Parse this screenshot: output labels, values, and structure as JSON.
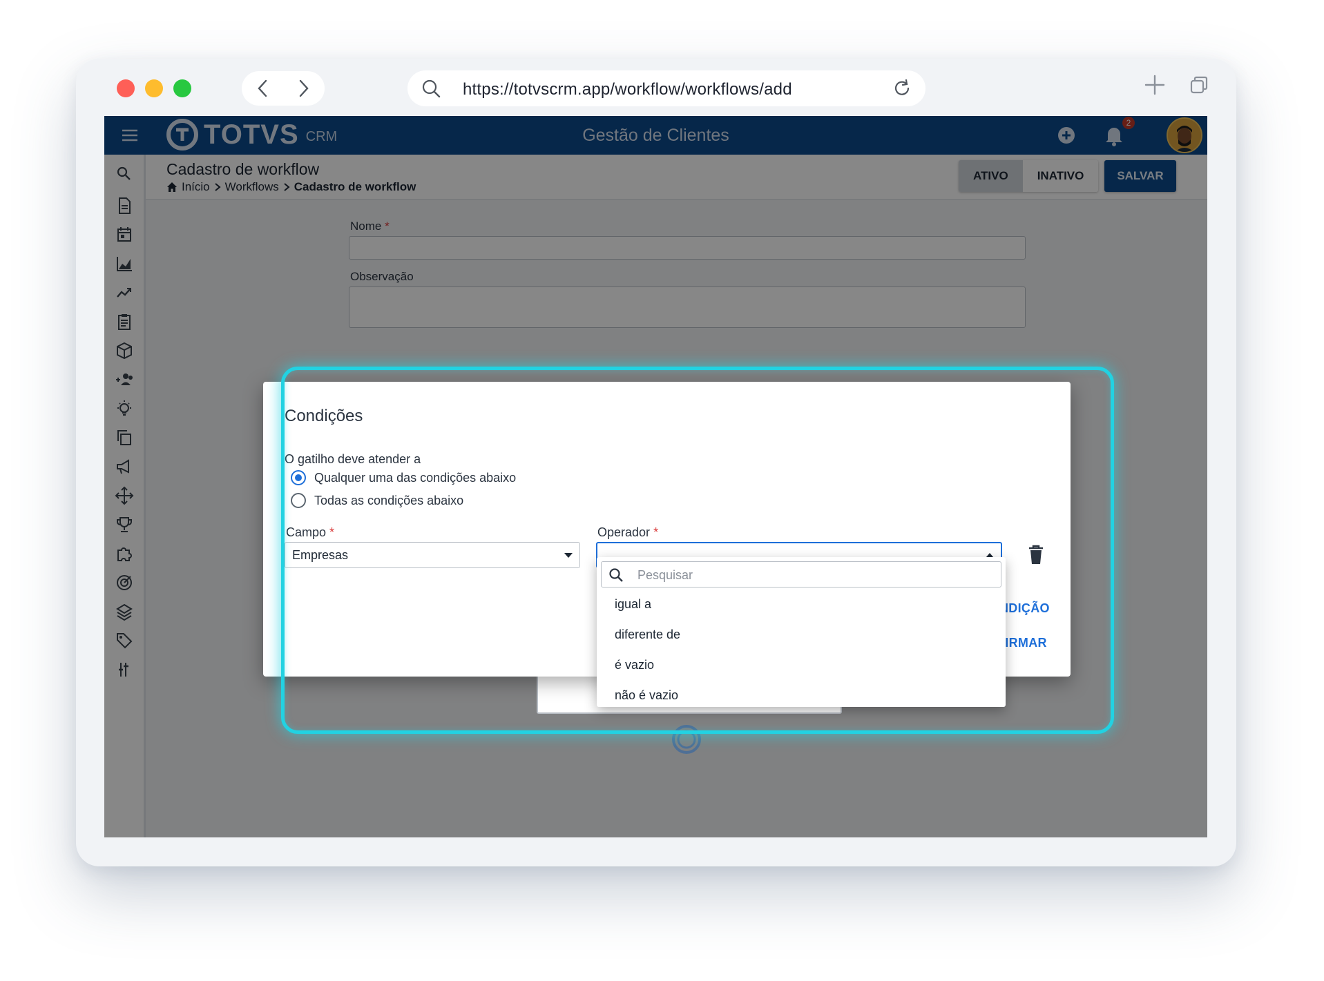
{
  "browser": {
    "url": "https://totvscrm.app/workflow/workflows/add"
  },
  "topbar": {
    "logo": "TOTVS",
    "logo_sub": "CRM",
    "app_title": "Gestão de Clientes",
    "notification_count": "2"
  },
  "sidebar": {
    "icons": [
      "search-icon",
      "document-icon",
      "calendar-icon",
      "area-chart-icon",
      "trend-icon",
      "clipboard-icon",
      "box-icon",
      "people-add-icon",
      "lightbulb-icon",
      "copy-icon",
      "megaphone-icon",
      "move-icon",
      "trophy-icon",
      "puzzle-icon",
      "target-icon",
      "layers-icon",
      "tag-icon",
      "settings-sliders-icon"
    ]
  },
  "page": {
    "title": "Cadastro de workflow",
    "breadcrumb": {
      "home": "Início",
      "parent": "Workflows",
      "current": "Cadastro de workflow"
    },
    "status_active": "ATIVO",
    "status_inactive": "INATIVO",
    "save_label": "SALVAR"
  },
  "form": {
    "name_label": "Nome",
    "obs_label": "Observação",
    "required_mark": "*"
  },
  "modal": {
    "title": "Condições",
    "trigger_label": "O gatilho deve atender a",
    "options": [
      {
        "label": "Qualquer uma das condições abaixo",
        "checked": true
      },
      {
        "label": "Todas as condições abaixo",
        "checked": false
      }
    ],
    "field_label": "Campo",
    "field_value": "Empresas",
    "operator_label": "Operador",
    "operator_value": "",
    "add_condition_label": "NDIÇÃO",
    "confirm_label": "FIRMAR"
  },
  "dropdown": {
    "search_placeholder": "Pesquisar",
    "items": [
      "igual a",
      "diferente de",
      "é vazio",
      "não é vazio"
    ]
  },
  "colors": {
    "brand": "#0c4a8c",
    "accent": "#1e6fd9",
    "highlight": "#22d2e2",
    "required": "#d93a3a"
  }
}
